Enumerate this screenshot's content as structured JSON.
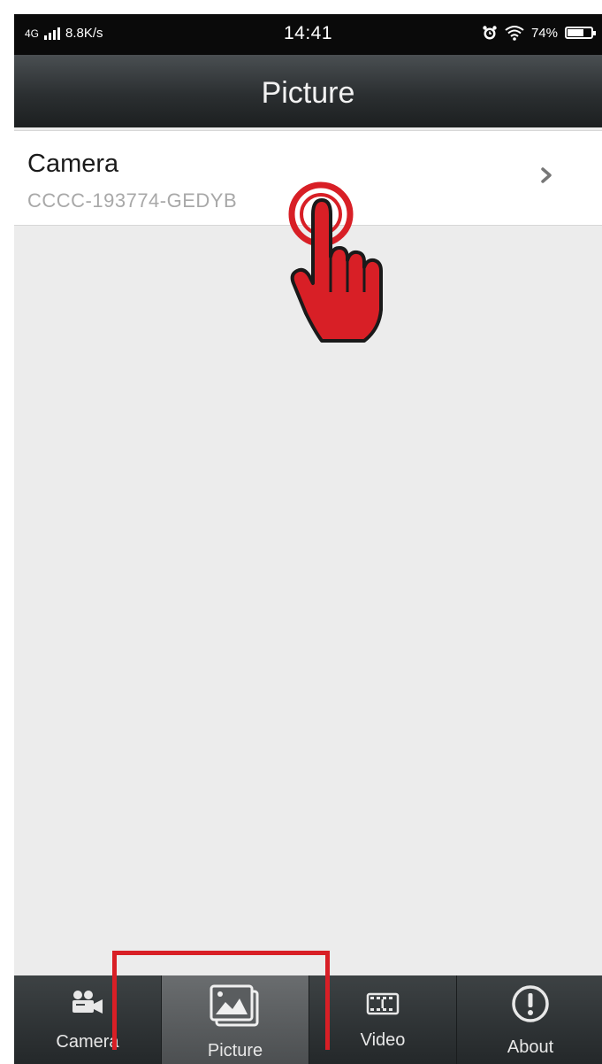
{
  "status_bar": {
    "network": "4G",
    "speed": "8.8K/s",
    "time": "14:41",
    "battery": "74%",
    "battery_level": 0.74,
    "icons": [
      "signal-icon",
      "alarm-icon",
      "wifi-icon",
      "battery-icon"
    ]
  },
  "nav": {
    "title": "Picture"
  },
  "list": {
    "items": [
      {
        "title": "Camera",
        "subtitle": "CCCC-193774-GEDYB",
        "icon": "chevron-right-icon"
      }
    ]
  },
  "overlay": {
    "icon": "tap-hand-icon",
    "highlight_color": "#d81f26"
  },
  "tab_bar": {
    "active_index": 1,
    "tabs": [
      {
        "label": "Camera",
        "icon": "camera-video-icon"
      },
      {
        "label": "Picture",
        "icon": "picture-icon"
      },
      {
        "label": "Video",
        "icon": "film-icon"
      },
      {
        "label": "About",
        "icon": "info-exclamation-icon"
      }
    ]
  },
  "colors": {
    "accent_red": "#d81f26",
    "nav_background": "#2b2f31",
    "content_background": "#ececec"
  }
}
